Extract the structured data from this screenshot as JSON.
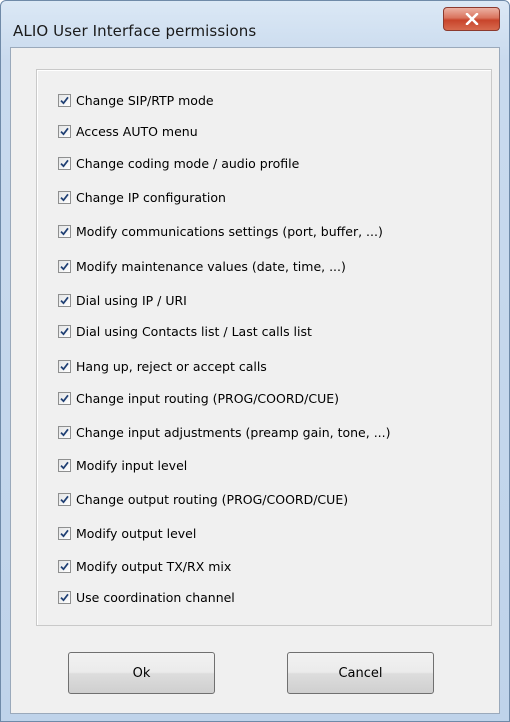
{
  "window": {
    "title": "ALIO User Interface permissions",
    "close_icon": "close-icon"
  },
  "permissions": [
    {
      "label": "Change SIP/RTP mode",
      "checked": true
    },
    {
      "label": "Access AUTO menu",
      "checked": true
    },
    {
      "label": "Change coding mode / audio profile",
      "checked": true
    },
    {
      "label": "Change IP configuration",
      "checked": true
    },
    {
      "label": "Modify communications settings (port, buffer, ...)",
      "checked": true
    },
    {
      "label": "Modify maintenance values (date, time, ...)",
      "checked": true
    },
    {
      "label": "Dial using IP / URI",
      "checked": true
    },
    {
      "label": "Dial using Contacts list / Last calls list",
      "checked": true
    },
    {
      "label": "Hang up, reject or accept calls",
      "checked": true
    },
    {
      "label": "Change input routing (PROG/COORD/CUE)",
      "checked": true
    },
    {
      "label": "Change input adjustments (preamp gain, tone, ...)",
      "checked": true
    },
    {
      "label": "Modify input level",
      "checked": true
    },
    {
      "label": "Change output routing (PROG/COORD/CUE)",
      "checked": true
    },
    {
      "label": "Modify output level",
      "checked": true
    },
    {
      "label": "Modify output TX/RX mix",
      "checked": true
    },
    {
      "label": "Use coordination channel",
      "checked": true
    }
  ],
  "buttons": {
    "ok_label": "Ok",
    "cancel_label": "Cancel"
  },
  "colors": {
    "check_mark": "#1f3f73",
    "close_button": "#c8442b"
  }
}
